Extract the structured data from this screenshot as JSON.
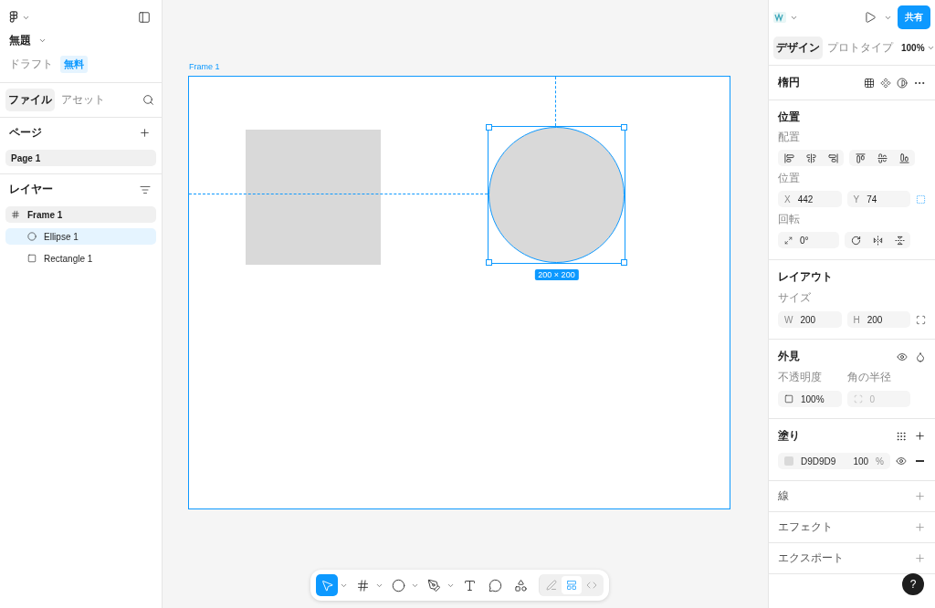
{
  "file": {
    "title": "無題",
    "status": "ドラフト",
    "plan": "無料"
  },
  "left_tabs": [
    {
      "label": "ファイル",
      "selected": true
    },
    {
      "label": "アセット",
      "selected": false
    }
  ],
  "pages": {
    "heading": "ページ",
    "items": [
      {
        "label": "Page 1",
        "selected": true
      }
    ]
  },
  "layers": {
    "heading": "レイヤー",
    "items": [
      {
        "label": "Frame 1",
        "kind": "frame",
        "selected": false,
        "children": [
          {
            "label": "Ellipse 1",
            "kind": "ellipse",
            "selected": true
          },
          {
            "label": "Rectangle 1",
            "kind": "rectangle",
            "selected": false
          }
        ]
      }
    ]
  },
  "canvas": {
    "frame_label": "Frame 1",
    "size_badge": "200 × 200"
  },
  "toolbar": {
    "tools": [
      {
        "kind": "move",
        "selected": true,
        "menu": true
      },
      {
        "kind": "frame",
        "selected": false,
        "menu": true
      },
      {
        "kind": "ellipse",
        "selected": false,
        "menu": true
      },
      {
        "kind": "pen",
        "selected": false,
        "menu": true
      },
      {
        "kind": "text",
        "selected": false,
        "menu": false
      },
      {
        "kind": "comment",
        "selected": false,
        "menu": false
      },
      {
        "kind": "actions",
        "selected": false,
        "menu": false
      }
    ],
    "modes": [
      {
        "kind": "draw",
        "selected": false
      },
      {
        "kind": "design",
        "selected": true
      },
      {
        "kind": "dev",
        "selected": false
      }
    ]
  },
  "inspector": {
    "share": "共有",
    "tabs": [
      {
        "label": "デザイン",
        "selected": true
      },
      {
        "label": "プロトタイプ",
        "selected": false
      }
    ],
    "zoom": "100%",
    "title": "楕円",
    "position": {
      "heading": "位置",
      "align_label": "配置",
      "position_label": "位置",
      "x": {
        "label": "X",
        "value": "442"
      },
      "y": {
        "label": "Y",
        "value": "74"
      },
      "rotation_label": "回転",
      "rotation": "0°"
    },
    "layout": {
      "heading": "レイアウト",
      "size_label": "サイズ",
      "w": {
        "label": "W",
        "value": "200"
      },
      "h": {
        "label": "H",
        "value": "200"
      }
    },
    "appearance": {
      "heading": "外見",
      "opacity_label": "不透明度",
      "opacity": "100%",
      "radius_label": "角の半径",
      "radius": "0",
      "radius_disabled": true
    },
    "fill": {
      "heading": "塗り",
      "hex": "D9D9D9",
      "color": "#d9d9d9",
      "opacity": "100",
      "unit": "%"
    },
    "collapsed_sections": [
      "線",
      "エフェクト",
      "エクスポート"
    ],
    "help": "?"
  }
}
